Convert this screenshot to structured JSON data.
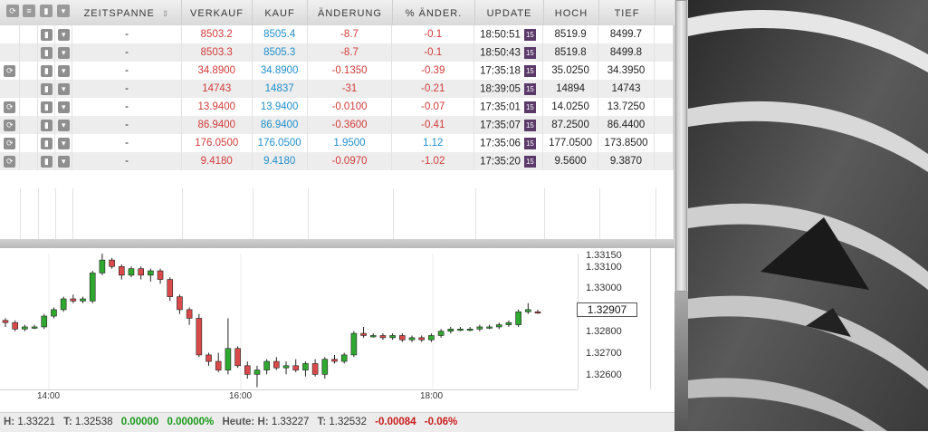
{
  "quote_table": {
    "columns": [
      "ZEITSPANNE",
      "VERKAUF",
      "KAUF",
      "ÄNDERUNG",
      "% ÄNDER.",
      "UPDATE",
      "HOCH",
      "TIEF"
    ],
    "rows": [
      {
        "zeitspanne": "-",
        "verkauf": "8503.2",
        "kauf": "8505.4",
        "aenderung": "-8.7",
        "pct": "-0.1",
        "update": "18:50:51",
        "badge": "15",
        "hoch": "8519.9",
        "tief": "8499.7",
        "dir": "neg",
        "has_link_icon": false
      },
      {
        "zeitspanne": "-",
        "verkauf": "8503.3",
        "kauf": "8505.3",
        "aenderung": "-8.7",
        "pct": "-0.1",
        "update": "18:50:43",
        "badge": "15",
        "hoch": "8519.8",
        "tief": "8499.8",
        "dir": "neg",
        "has_link_icon": false
      },
      {
        "zeitspanne": "-",
        "verkauf": "34.8900",
        "kauf": "34.8900",
        "aenderung": "-0.1350",
        "pct": "-0.39",
        "update": "17:35:18",
        "badge": "15",
        "hoch": "35.0250",
        "tief": "34.3950",
        "dir": "neg",
        "has_link_icon": true
      },
      {
        "zeitspanne": "-",
        "verkauf": "14743",
        "kauf": "14837",
        "aenderung": "-31",
        "pct": "-0.21",
        "update": "18:39:05",
        "badge": "15",
        "hoch": "14894",
        "tief": "14743",
        "dir": "neg",
        "has_link_icon": false
      },
      {
        "zeitspanne": "-",
        "verkauf": "13.9400",
        "kauf": "13.9400",
        "aenderung": "-0.0100",
        "pct": "-0.07",
        "update": "17:35:01",
        "badge": "15",
        "hoch": "14.0250",
        "tief": "13.7250",
        "dir": "neg",
        "has_link_icon": true
      },
      {
        "zeitspanne": "-",
        "verkauf": "86.9400",
        "kauf": "86.9400",
        "aenderung": "-0.3600",
        "pct": "-0.41",
        "update": "17:35:07",
        "badge": "15",
        "hoch": "87.2500",
        "tief": "86.4400",
        "dir": "neg",
        "has_link_icon": true
      },
      {
        "zeitspanne": "-",
        "verkauf": "176.0500",
        "kauf": "176.0500",
        "aenderung": "1.9500",
        "pct": "1.12",
        "update": "17:35:06",
        "badge": "15",
        "hoch": "177.0500",
        "tief": "173.8500",
        "dir": "pos",
        "has_link_icon": true
      },
      {
        "zeitspanne": "-",
        "verkauf": "9.4180",
        "kauf": "9.4180",
        "aenderung": "-0.0970",
        "pct": "-1.02",
        "update": "17:35:20",
        "badge": "15",
        "hoch": "9.5600",
        "tief": "9.3870",
        "dir": "neg",
        "has_link_icon": true
      }
    ]
  },
  "chart": {
    "price_ticks": [
      "1.33150",
      "1.33100",
      "1.33000",
      "1.32800",
      "1.32700",
      "1.32600"
    ],
    "current_price": "1.32907",
    "time_ticks": [
      "14:00",
      "16:00",
      "18:00"
    ]
  },
  "status": {
    "h_label": "H:",
    "h_val": "1.33221",
    "t_label": "T:",
    "t_val": "1.32538",
    "chg": "0.00000",
    "chg_pct": "0.00000%",
    "today_label": "Heute:",
    "today_h": "1.33227",
    "today_t": "1.32532",
    "today_chg": "-0.00084",
    "today_pct": "-0.06%"
  },
  "chart_data": {
    "type": "candlestick",
    "y_range": [
      1.3255,
      1.3318
    ],
    "candles": [
      [
        1.3287,
        1.3288,
        1.3284,
        1.3286
      ],
      [
        1.3286,
        1.3287,
        1.3282,
        1.3283
      ],
      [
        1.3283,
        1.3285,
        1.3282,
        1.3284
      ],
      [
        1.3284,
        1.3285,
        1.3283,
        1.3284
      ],
      [
        1.3284,
        1.329,
        1.3283,
        1.3289
      ],
      [
        1.3289,
        1.3293,
        1.3288,
        1.3292
      ],
      [
        1.3292,
        1.3298,
        1.3291,
        1.3297
      ],
      [
        1.3297,
        1.3299,
        1.3295,
        1.3296
      ],
      [
        1.3296,
        1.3298,
        1.3295,
        1.3297
      ],
      [
        1.3296,
        1.331,
        1.3295,
        1.3309
      ],
      [
        1.3309,
        1.3318,
        1.3308,
        1.3315
      ],
      [
        1.3315,
        1.3316,
        1.3311,
        1.3312
      ],
      [
        1.3312,
        1.3313,
        1.3306,
        1.3308
      ],
      [
        1.3308,
        1.3312,
        1.3307,
        1.3311
      ],
      [
        1.3311,
        1.3312,
        1.3306,
        1.3308
      ],
      [
        1.3308,
        1.3311,
        1.3305,
        1.331
      ],
      [
        1.331,
        1.3311,
        1.3304,
        1.3306
      ],
      [
        1.3306,
        1.3307,
        1.3296,
        1.3298
      ],
      [
        1.3298,
        1.3299,
        1.329,
        1.3292
      ],
      [
        1.3292,
        1.3293,
        1.3285,
        1.3288
      ],
      [
        1.3288,
        1.329,
        1.327,
        1.3271
      ],
      [
        1.3271,
        1.3272,
        1.3266,
        1.3268
      ],
      [
        1.3268,
        1.3272,
        1.3263,
        1.3264
      ],
      [
        1.3264,
        1.3288,
        1.3262,
        1.3274
      ],
      [
        1.3274,
        1.3275,
        1.3265,
        1.3266
      ],
      [
        1.3266,
        1.3268,
        1.326,
        1.3262
      ],
      [
        1.3262,
        1.3266,
        1.3256,
        1.3264
      ],
      [
        1.3264,
        1.3269,
        1.3262,
        1.3268
      ],
      [
        1.3268,
        1.327,
        1.3264,
        1.3265
      ],
      [
        1.3265,
        1.3268,
        1.3262,
        1.3266
      ],
      [
        1.3266,
        1.3269,
        1.3263,
        1.3264
      ],
      [
        1.3264,
        1.3268,
        1.3261,
        1.3267
      ],
      [
        1.3267,
        1.3269,
        1.3261,
        1.3262
      ],
      [
        1.3262,
        1.327,
        1.326,
        1.3269
      ],
      [
        1.3269,
        1.3271,
        1.3267,
        1.3268
      ],
      [
        1.3268,
        1.3272,
        1.3267,
        1.3271
      ],
      [
        1.3271,
        1.3282,
        1.327,
        1.3281
      ],
      [
        1.3281,
        1.3284,
        1.3279,
        1.328
      ],
      [
        1.328,
        1.3281,
        1.3279,
        1.328
      ],
      [
        1.328,
        1.3281,
        1.3278,
        1.3279
      ],
      [
        1.3279,
        1.3281,
        1.3278,
        1.328
      ],
      [
        1.328,
        1.3281,
        1.3277,
        1.3278
      ],
      [
        1.3278,
        1.328,
        1.3277,
        1.3279
      ],
      [
        1.3279,
        1.328,
        1.3277,
        1.3278
      ],
      [
        1.3278,
        1.3281,
        1.3277,
        1.328
      ],
      [
        1.328,
        1.3283,
        1.3279,
        1.3282
      ],
      [
        1.3282,
        1.3284,
        1.3281,
        1.3283
      ],
      [
        1.3283,
        1.3284,
        1.3282,
        1.3283
      ],
      [
        1.3283,
        1.3284,
        1.3282,
        1.3283
      ],
      [
        1.3283,
        1.3285,
        1.3282,
        1.3284
      ],
      [
        1.3284,
        1.3285,
        1.3283,
        1.3284
      ],
      [
        1.3284,
        1.3286,
        1.3283,
        1.3285
      ],
      [
        1.3285,
        1.3287,
        1.3284,
        1.3286
      ],
      [
        1.3285,
        1.3292,
        1.3284,
        1.3291
      ],
      [
        1.3291,
        1.3295,
        1.329,
        1.3292
      ],
      [
        1.3291,
        1.3292,
        1.329,
        1.32907
      ]
    ]
  }
}
